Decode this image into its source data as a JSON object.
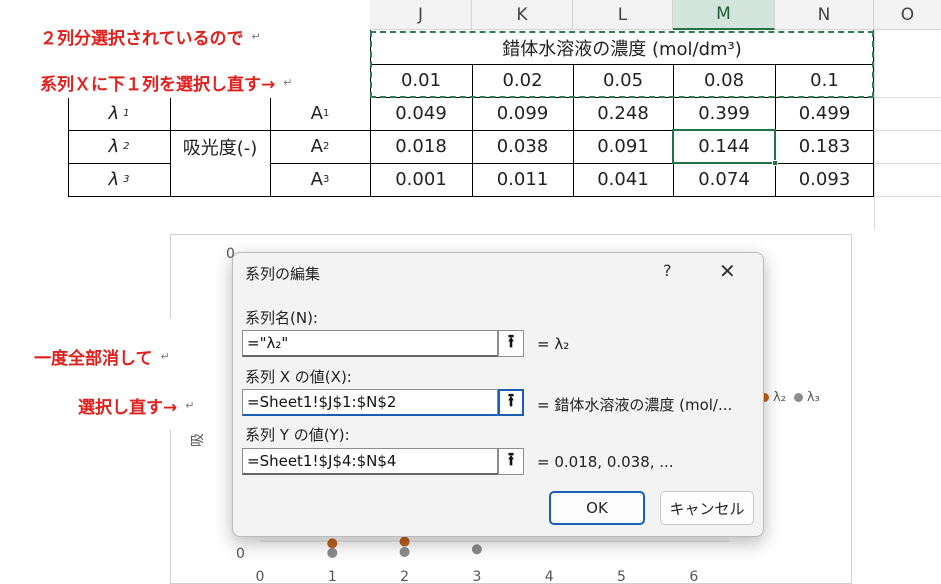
{
  "columns": {
    "J": "J",
    "K": "K",
    "L": "L",
    "M": "M",
    "N": "N",
    "O": "O"
  },
  "notes": {
    "n1": "２列分選択されているので",
    "n2": "系列Ｘに下１列を選択し直す→",
    "n3": "一度全部消して",
    "n4": "選択し直す→",
    "ret": "↵"
  },
  "table": {
    "header": "錯体水溶液の濃度 (mol/dm³)",
    "concentrations": [
      "0.01",
      "0.02",
      "0.05",
      "0.08",
      "0.1"
    ],
    "group_label": "吸光度(-)",
    "rows": [
      {
        "lambda": "λ",
        "sub": "1",
        "a": "A",
        "asub": "1",
        "values": [
          "0.049",
          "0.099",
          "0.248",
          "0.399",
          "0.499"
        ]
      },
      {
        "lambda": "λ",
        "sub": "2",
        "a": "A",
        "asub": "2",
        "values": [
          "0.018",
          "0.038",
          "0.091",
          "0.144",
          "0.183"
        ]
      },
      {
        "lambda": "λ",
        "sub": "3",
        "a": "A",
        "asub": "3",
        "values": [
          "0.001",
          "0.011",
          "0.041",
          "0.074",
          "0.093"
        ]
      }
    ]
  },
  "chart": {
    "y_tick_top": "0",
    "y_tick_zero": "0",
    "y_title_partial": "吸",
    "x_ticks": [
      "0",
      "1",
      "2",
      "3",
      "4",
      "5",
      "6"
    ],
    "legend": {
      "l2": "λ₂",
      "l3": "λ₃"
    },
    "colors": {
      "series2": "#c0631f",
      "series3": "#8c8c8c"
    }
  },
  "chart_data": {
    "type": "scatter",
    "x_ticks": [
      0,
      1,
      2,
      3,
      4,
      5,
      6
    ],
    "series": [
      {
        "name": "λ₂",
        "x": [
          1,
          2
        ],
        "y": [
          0.018,
          0.038
        ]
      },
      {
        "name": "λ₃",
        "x": [
          1,
          2,
          3
        ],
        "y": [
          0.001,
          0.011,
          0.041
        ]
      }
    ]
  },
  "dialog": {
    "title": "系列の編集",
    "help": "?",
    "close": "✕",
    "name_label": "系列名(N):",
    "name_value": "=\"λ₂\"",
    "name_result": "= λ₂",
    "x_label": "系列 X の値(X):",
    "x_value": "=Sheet1!$J$1:$N$2",
    "x_result": "= 錯体水溶液の濃度 (mol/...",
    "y_label": "系列 Y の値(Y):",
    "y_value": "=Sheet1!$J$4:$N$4",
    "y_result": "= 0.018, 0.038, ...",
    "ok": "OK",
    "cancel": "キャンセル",
    "ref_icon": "collapse-range-icon"
  }
}
